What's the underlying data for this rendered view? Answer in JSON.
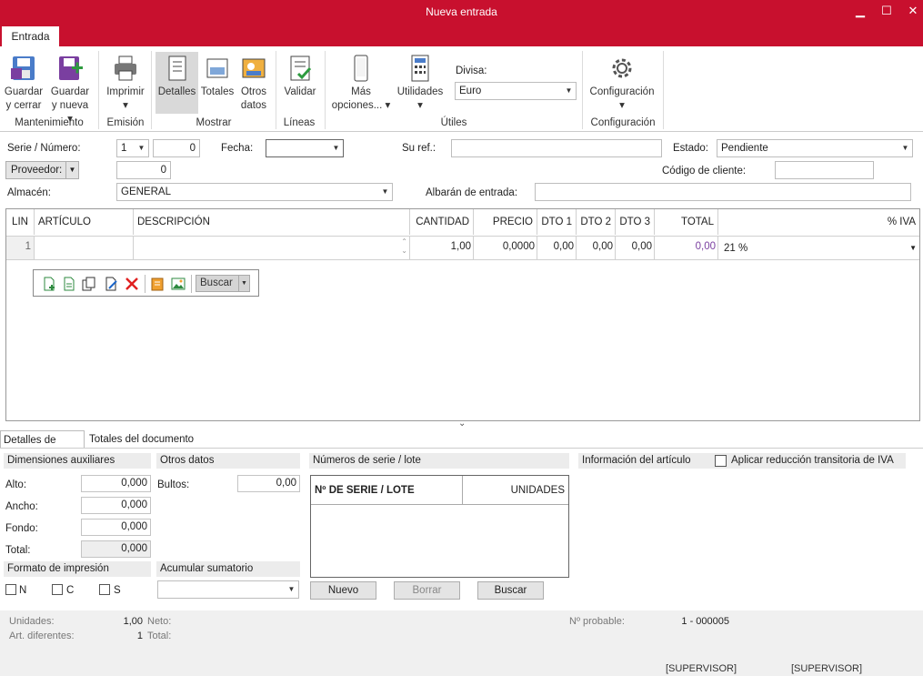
{
  "window": {
    "title": "Nueva entrada"
  },
  "tabs": {
    "active": "Entrada"
  },
  "ribbon": {
    "guardar_cerrar": [
      "Guardar",
      "y cerrar"
    ],
    "guardar_nueva": [
      "Guardar",
      "y nueva ▾"
    ],
    "imprimir": [
      "Imprimir",
      "▾"
    ],
    "detalles": "Detalles",
    "totales": "Totales",
    "otros_datos": [
      "Otros",
      "datos"
    ],
    "validar": "Validar",
    "mas_opciones": [
      "Más",
      "opciones... ▾"
    ],
    "utilidades": [
      "Utilidades",
      "▾"
    ],
    "divisa_label": "Divisa:",
    "divisa_value": "Euro",
    "configuracion": [
      "Configuración",
      "▾"
    ],
    "groups": {
      "mantenimiento": "Mantenimiento",
      "emision": "Emisión",
      "mostrar": "Mostrar",
      "lineas": "Líneas",
      "utiles": "Útiles",
      "configuracion": "Configuración"
    }
  },
  "form": {
    "serie_label": "Serie / Número:",
    "serie_value": "1",
    "numero_value": "0",
    "fecha_label": "Fecha:",
    "fecha_value": "",
    "suref_label": "Su ref.:",
    "suref_value": "",
    "estado_label": "Estado:",
    "estado_value": "Pendiente",
    "proveedor_label": "Proveedor:",
    "proveedor_value": "0",
    "codigo_cliente_label": "Código de cliente:",
    "codigo_cliente_value": "",
    "almacen_label": "Almacén:",
    "almacen_value": "GENERAL",
    "albaran_label": "Albarán de entrada:",
    "albaran_value": ""
  },
  "grid": {
    "headers": [
      "LIN",
      "ARTÍCULO",
      "DESCRIPCIÓN",
      "CANTIDAD",
      "PRECIO",
      "DTO 1",
      "DTO 2",
      "DTO 3",
      "TOTAL",
      "% IVA"
    ],
    "rows": [
      {
        "lin": "1",
        "articulo": "",
        "descripcion": "",
        "cantidad": "1,00",
        "precio": "0,0000",
        "dto1": "0,00",
        "dto2": "0,00",
        "dto3": "0,00",
        "total": "0,00",
        "iva": "21 %"
      }
    ],
    "toolbar_search": "Buscar"
  },
  "bottom_tabs": [
    "Detalles de línea",
    "Totales del documento"
  ],
  "dimensiones": {
    "title": "Dimensiones auxiliares",
    "alto_label": "Alto:",
    "alto": "0,000",
    "ancho_label": "Ancho:",
    "ancho": "0,000",
    "fondo_label": "Fondo:",
    "fondo": "0,000",
    "total_label": "Total:",
    "total": "0,000"
  },
  "otros": {
    "title": "Otros datos",
    "bultos_label": "Bultos:",
    "bultos": "0,00"
  },
  "formato": {
    "title": "Formato de impresión",
    "n": "N",
    "c": "C",
    "s": "S"
  },
  "acumular": {
    "title": "Acumular sumatorio",
    "value": ""
  },
  "series": {
    "title": "Números de serie / lote",
    "col1": "Nº DE SERIE / LOTE",
    "col2": "UNIDADES",
    "nuevo": "Nuevo",
    "borrar": "Borrar",
    "buscar": "Buscar"
  },
  "info": {
    "title": "Información del artículo",
    "iva_check": "Aplicar reducción transitoria de IVA"
  },
  "status": {
    "unidades_label": "Unidades:",
    "unidades": "1,00",
    "art_label": "Art. diferentes:",
    "art": "1",
    "neto_label": "Neto:",
    "total_label": "Total:",
    "probable_label": "Nº probable:",
    "probable": "1 - 000005",
    "user1": "[SUPERVISOR]",
    "user2": "[SUPERVISOR]"
  },
  "colors": {
    "accent": "#c8102e"
  }
}
